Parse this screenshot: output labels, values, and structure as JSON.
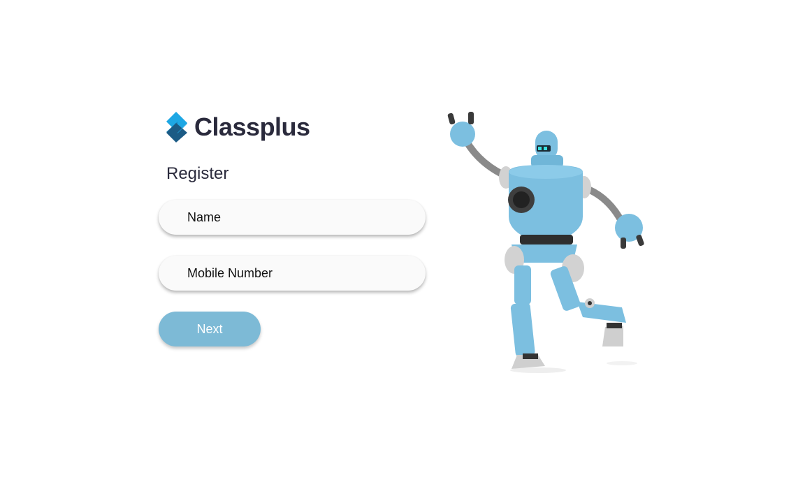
{
  "brand": {
    "name": "Classplus",
    "logo_icon": "classplus-diamond-logo",
    "colors": {
      "logo_light": "#1ea7e4",
      "logo_dark": "#1b5b85",
      "text": "#2a2a3c",
      "button": "#7dbad6"
    }
  },
  "form": {
    "title": "Register",
    "name_placeholder": "Name",
    "mobile_placeholder": "Mobile Number",
    "next_label": "Next"
  },
  "illustration": {
    "icon": "waving-robot-illustration"
  }
}
